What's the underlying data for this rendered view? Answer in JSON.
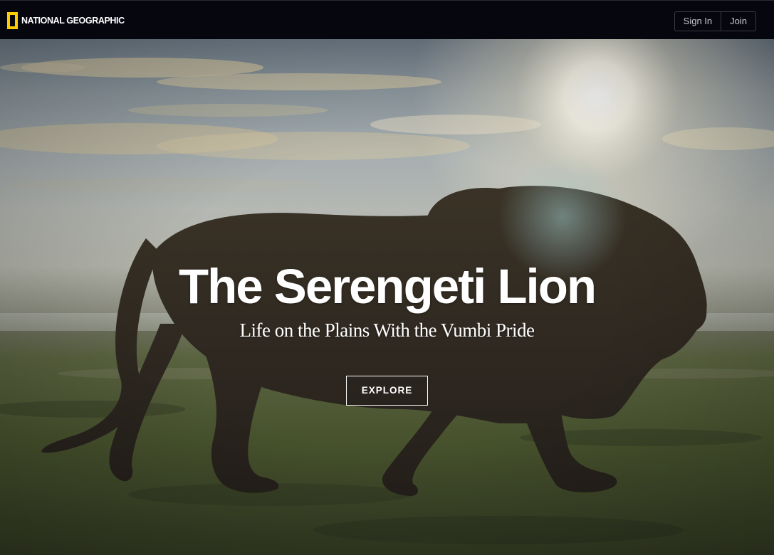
{
  "header": {
    "brand": "NATIONAL GEOGRAPHIC",
    "brand_color": "#ffcc00",
    "background": "#06060f",
    "sign_in": "Sign In",
    "join": "Join"
  },
  "hero": {
    "title": "The Serengeti Lion",
    "subtitle": "Life on the Plains With the Vumbi Pride",
    "cta": "EXPLORE",
    "image": "lion-silhouette-savanna-sunset"
  }
}
